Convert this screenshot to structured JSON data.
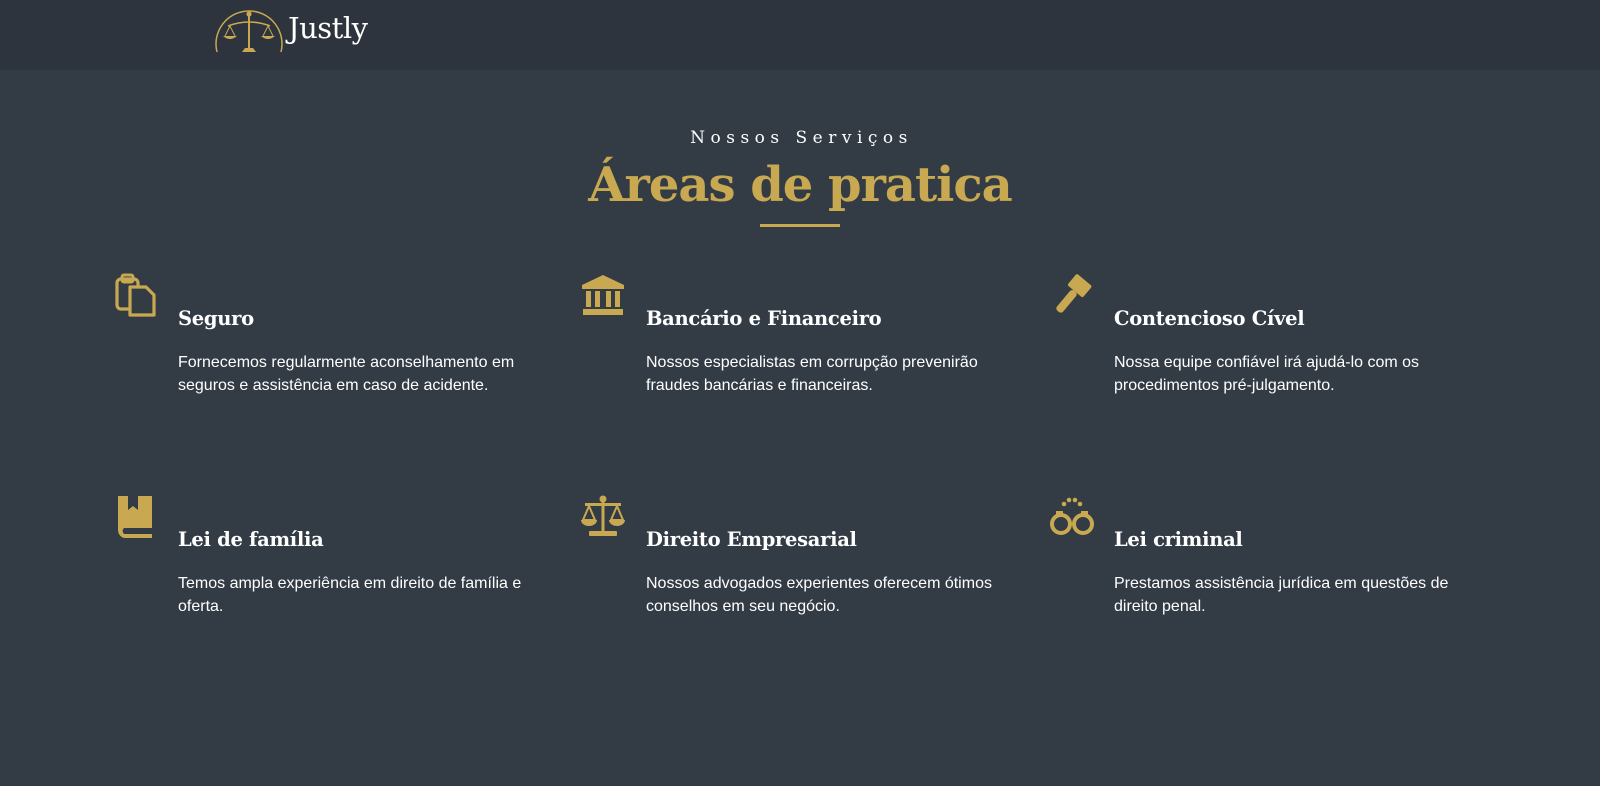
{
  "brand": {
    "name": "Justly",
    "accent": "#c8a951",
    "nav_bg": "#2e343d",
    "page_bg": "#333b45"
  },
  "section": {
    "eyebrow": "Nossos Serviços",
    "title": "Áreas de pratica"
  },
  "services": [
    {
      "icon": "clipboard-icon",
      "title": "Seguro",
      "description": "Fornecemos regularmente aconselhamento em seguros e assistência em caso de acidente."
    },
    {
      "icon": "bank-icon",
      "title": "Bancário e Financeiro",
      "description": "Nossos especialistas em corrupção prevenirão fraudes bancárias e financeiras."
    },
    {
      "icon": "gavel-icon",
      "title": "Contencioso Cível",
      "description": "Nossa equipe confiável irá ajudá-lo com os procedimentos pré-julgamento."
    },
    {
      "icon": "book-icon",
      "title": "Lei de família",
      "description": "Temos ampla experiência em direito de família e oferta."
    },
    {
      "icon": "scale-icon",
      "title": "Direito Empresarial",
      "description": "Nossos advogados experientes oferecem ótimos conselhos em seu negócio."
    },
    {
      "icon": "handcuffs-icon",
      "title": "Lei criminal",
      "description": "Prestamos assistência jurídica em questões de direito penal."
    }
  ]
}
